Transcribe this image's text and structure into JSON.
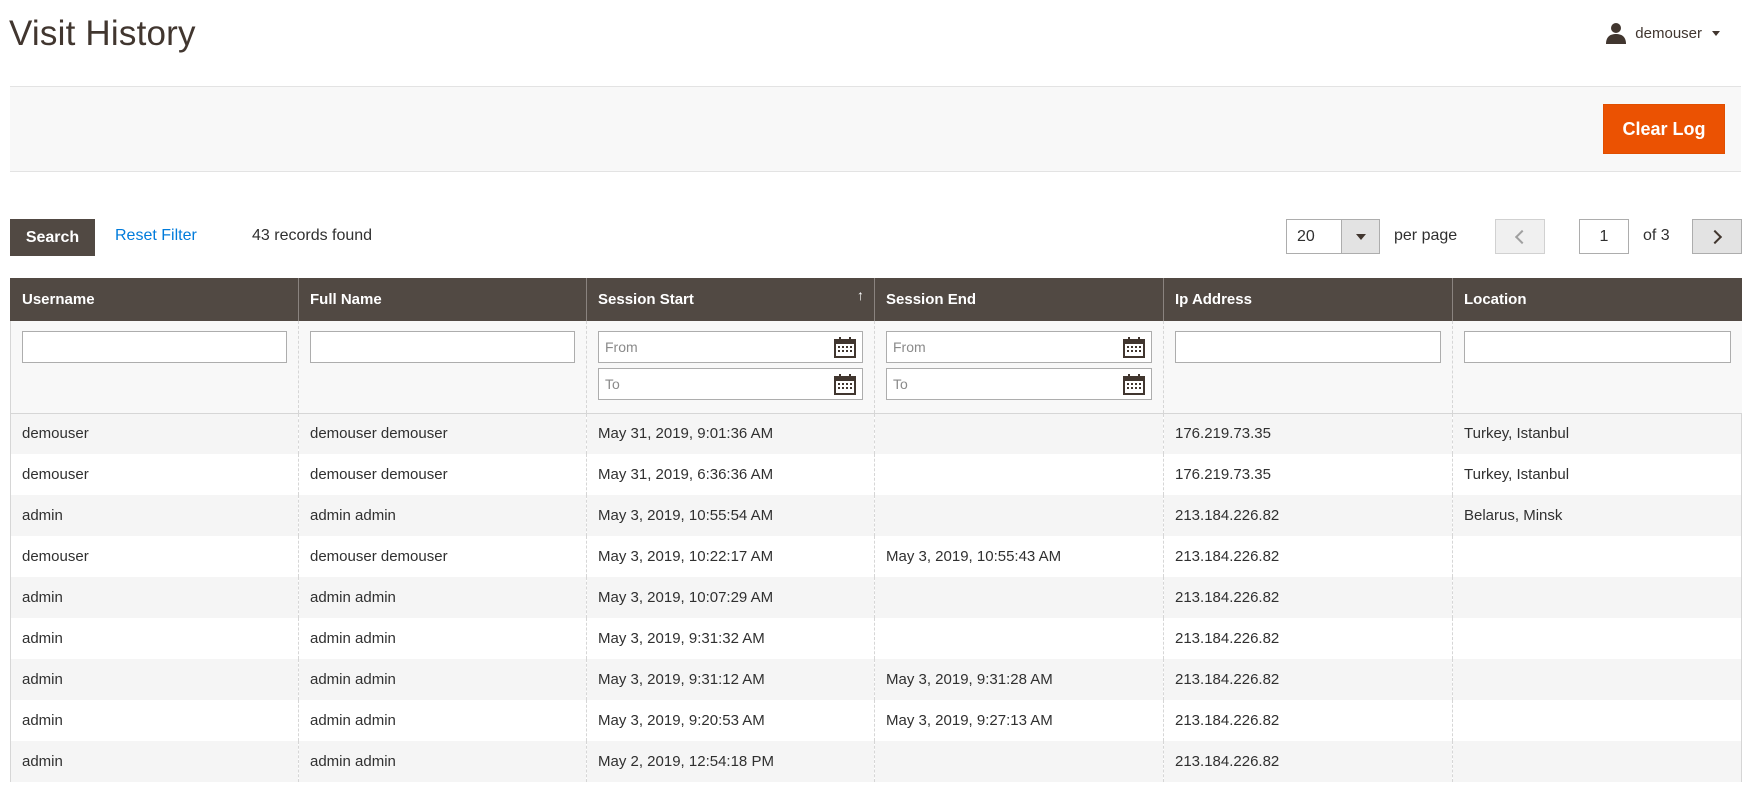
{
  "header": {
    "title": "Visit History",
    "user": "demouser"
  },
  "actions": {
    "clear_log": "Clear Log"
  },
  "toolbar": {
    "search": "Search",
    "reset_filter": "Reset Filter",
    "records_found": "43 records found",
    "per_page_value": "20",
    "per_page_label": "per page",
    "current_page": "1",
    "total_pages_label": "of 3"
  },
  "grid": {
    "columns": [
      "Username",
      "Full Name",
      "Session Start",
      "Session End",
      "Ip Address",
      "Location"
    ],
    "sorted_column": "Session Start",
    "sort_indicator": "↑",
    "filter_placeholders": {
      "from": "From",
      "to": "To"
    },
    "rows": [
      [
        "demouser",
        "demouser demouser",
        "May 31, 2019, 9:01:36 AM",
        "",
        "176.219.73.35",
        "Turkey, Istanbul"
      ],
      [
        "demouser",
        "demouser demouser",
        "May 31, 2019, 6:36:36 AM",
        "",
        "176.219.73.35",
        "Turkey, Istanbul"
      ],
      [
        "admin",
        "admin admin",
        "May 3, 2019, 10:55:54 AM",
        "",
        "213.184.226.82",
        "Belarus, Minsk"
      ],
      [
        "demouser",
        "demouser demouser",
        "May 3, 2019, 10:22:17 AM",
        "May 3, 2019, 10:55:43 AM",
        "213.184.226.82",
        ""
      ],
      [
        "admin",
        "admin admin",
        "May 3, 2019, 10:07:29 AM",
        "",
        "213.184.226.82",
        ""
      ],
      [
        "admin",
        "admin admin",
        "May 3, 2019, 9:31:32 AM",
        "",
        "213.184.226.82",
        ""
      ],
      [
        "admin",
        "admin admin",
        "May 3, 2019, 9:31:12 AM",
        "May 3, 2019, 9:31:28 AM",
        "213.184.226.82",
        ""
      ],
      [
        "admin",
        "admin admin",
        "May 3, 2019, 9:20:53 AM",
        "May 3, 2019, 9:27:13 AM",
        "213.184.226.82",
        ""
      ],
      [
        "admin",
        "admin admin",
        "May 2, 2019, 12:54:18 PM",
        "",
        "213.184.226.82",
        ""
      ]
    ]
  }
}
